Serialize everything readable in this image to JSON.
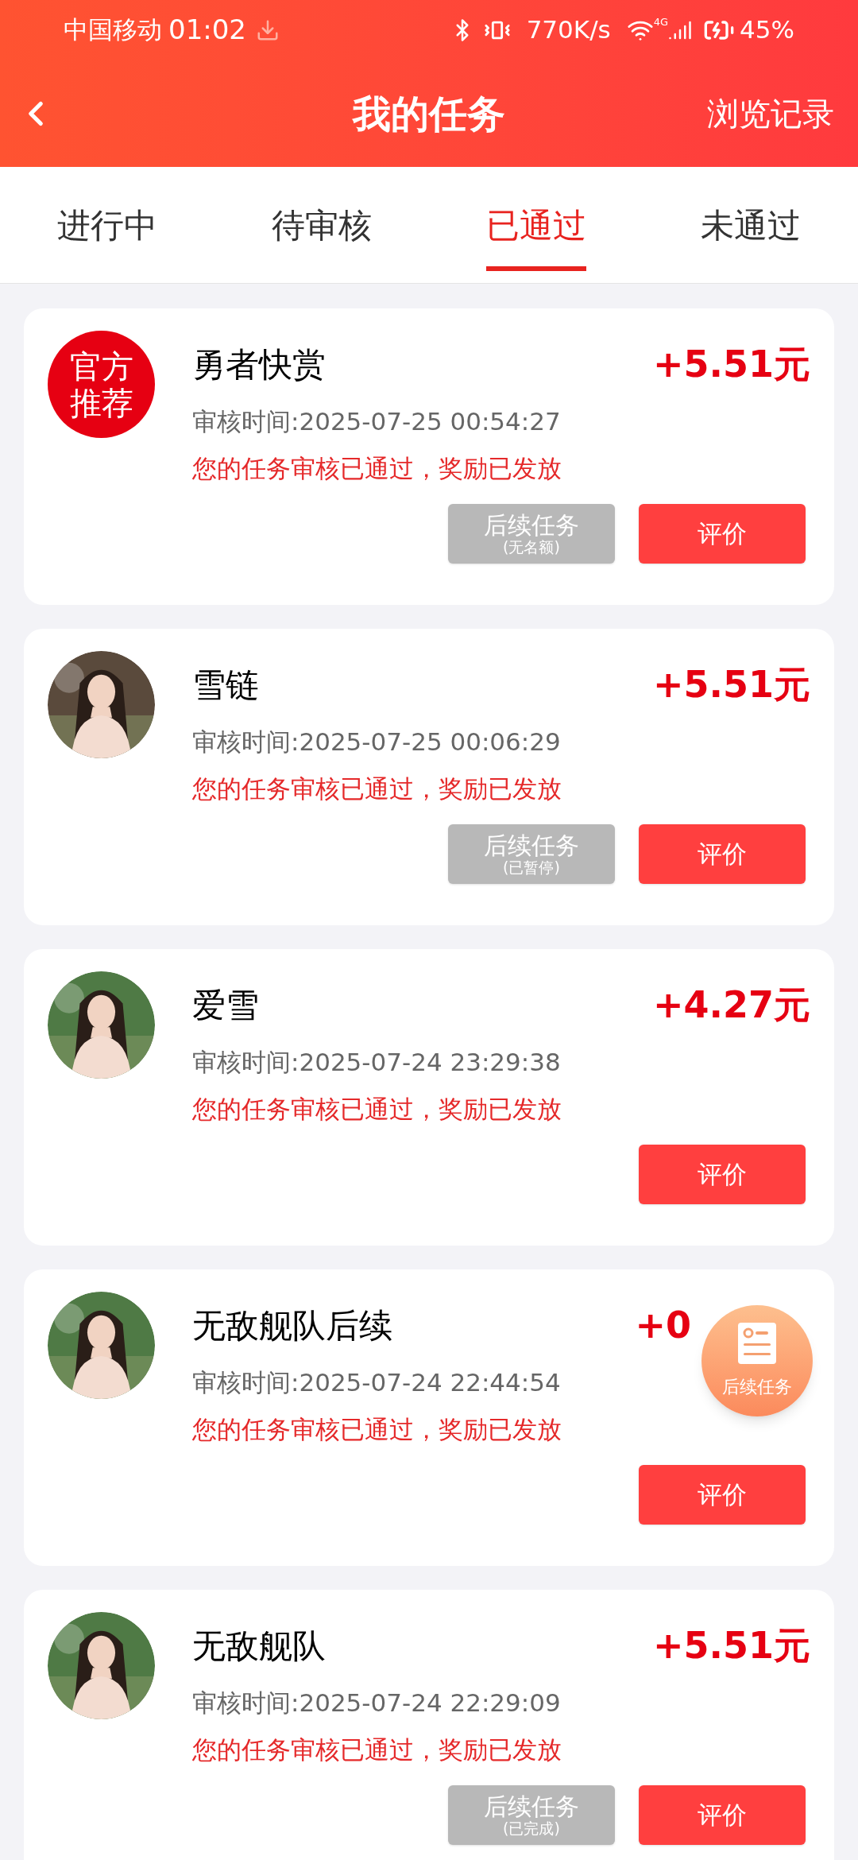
{
  "status_bar": {
    "carrier": "中国移动",
    "time": "01:02",
    "speed": "770K/s",
    "network": "4G",
    "battery": "45%"
  },
  "header": {
    "title": "我的任务",
    "action": "浏览记录"
  },
  "tabs": [
    {
      "label": "进行中",
      "selected": false
    },
    {
      "label": "待审核",
      "selected": false
    },
    {
      "label": "已通过",
      "selected": true
    },
    {
      "label": "未通过",
      "selected": false
    }
  ],
  "tasks": [
    {
      "avatar": {
        "kind": "badge",
        "text": "官方推荐"
      },
      "title": "勇者快赏",
      "amount": "+5.51元",
      "review_time": "审核时间:2025-07-25 00:54:27",
      "status": "您的任务审核已通过，奖励已发放",
      "follow_up": {
        "label": "后续任务",
        "note": "(无名额)"
      },
      "action": "评价"
    },
    {
      "title": "雪链",
      "amount": "+5.51元",
      "review_time": "审核时间:2025-07-25 00:06:29",
      "status": "您的任务审核已通过，奖励已发放",
      "follow_up": {
        "label": "后续任务",
        "note": "(已暂停)"
      },
      "action": "评价"
    },
    {
      "title": "爱雪",
      "amount": "+4.27元",
      "review_time": "审核时间:2025-07-24 23:29:38",
      "status": "您的任务审核已通过，奖励已发放",
      "action": "评价"
    },
    {
      "title": "无敌舰队后续",
      "amount": "+0",
      "amount_covered": true,
      "review_time": "审核时间:2025-07-24 22:44:54",
      "status": "您的任务审核已通过，奖励已发放",
      "action": "评价"
    },
    {
      "title": "无敌舰队",
      "amount": "+5.51元",
      "review_time": "审核时间:2025-07-24 22:29:09",
      "status": "您的任务审核已通过，奖励已发放",
      "follow_up": {
        "label": "后续任务",
        "note": "(已完成)"
      },
      "action": "评价"
    }
  ],
  "floating_button": {
    "label": "后续任务"
  }
}
